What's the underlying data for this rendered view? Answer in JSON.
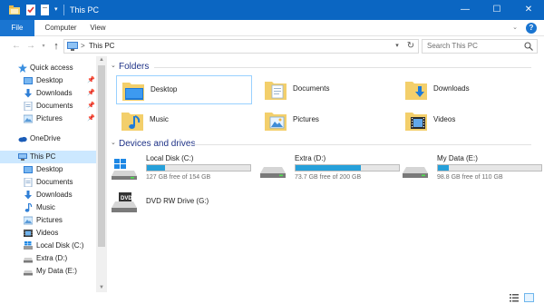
{
  "window": {
    "title": "This PC"
  },
  "titlebar": {
    "dropdown_glyph": "▾",
    "minimize": "—",
    "maximize": "☐",
    "close": "✕"
  },
  "ribbon": {
    "tabs": [
      "File",
      "Computer",
      "View"
    ],
    "chevron": "⌄",
    "help": "?"
  },
  "navigation": {
    "back": "←",
    "forward": "→",
    "recent": "▾",
    "up": "↑",
    "refresh": "↻"
  },
  "address": {
    "separator": ">",
    "path": "This PC",
    "dropdown": "▾"
  },
  "search": {
    "placeholder": "Search This PC"
  },
  "sidebar": {
    "quick_access": {
      "label": "Quick access",
      "items": [
        {
          "label": "Desktop",
          "pinned": true
        },
        {
          "label": "Downloads",
          "pinned": true
        },
        {
          "label": "Documents",
          "pinned": true
        },
        {
          "label": "Pictures",
          "pinned": true
        }
      ]
    },
    "onedrive": {
      "label": "OneDrive"
    },
    "this_pc": {
      "label": "This PC",
      "selected": true,
      "items": [
        {
          "label": "Desktop"
        },
        {
          "label": "Documents"
        },
        {
          "label": "Downloads"
        },
        {
          "label": "Music"
        },
        {
          "label": "Pictures"
        },
        {
          "label": "Videos"
        },
        {
          "label": "Local Disk (C:)"
        },
        {
          "label": "Extra (D:)"
        },
        {
          "label": "My Data (E:)"
        }
      ]
    },
    "pin_glyph": "📌"
  },
  "content": {
    "folders": {
      "title": "Folders",
      "chevron": "⌄",
      "items": [
        {
          "label": "Desktop",
          "icon": "desktop-folder-icon",
          "selected": true
        },
        {
          "label": "Documents",
          "icon": "documents-folder-icon"
        },
        {
          "label": "Downloads",
          "icon": "downloads-folder-icon"
        },
        {
          "label": "Music",
          "icon": "music-folder-icon"
        },
        {
          "label": "Pictures",
          "icon": "pictures-folder-icon"
        },
        {
          "label": "Videos",
          "icon": "videos-folder-icon"
        }
      ]
    },
    "drives": {
      "title": "Devices and drives",
      "chevron": "⌄",
      "items": [
        {
          "label": "Local Disk (C:)",
          "free_text": "127 GB free of 154 GB",
          "free_gb": 127,
          "total_gb": 154,
          "icon": "windows-drive-icon"
        },
        {
          "label": "Extra (D:)",
          "free_text": "73.7 GB free of 200 GB",
          "free_gb": 73.7,
          "total_gb": 200,
          "icon": "hard-drive-icon"
        },
        {
          "label": "My Data (E:)",
          "free_text": "98.8 GB free of 110 GB",
          "free_gb": 98.8,
          "total_gb": 110,
          "icon": "hard-drive-icon"
        },
        {
          "label": "DVD RW Drive (G:)",
          "icon": "dvd-drive-icon"
        }
      ]
    }
  },
  "colors": {
    "title_bar": "#0b66c2",
    "accent": "#1a75d1",
    "selection": "#cce8ff",
    "usage_bar": "#26a0da",
    "section_title": "#1e3287"
  }
}
